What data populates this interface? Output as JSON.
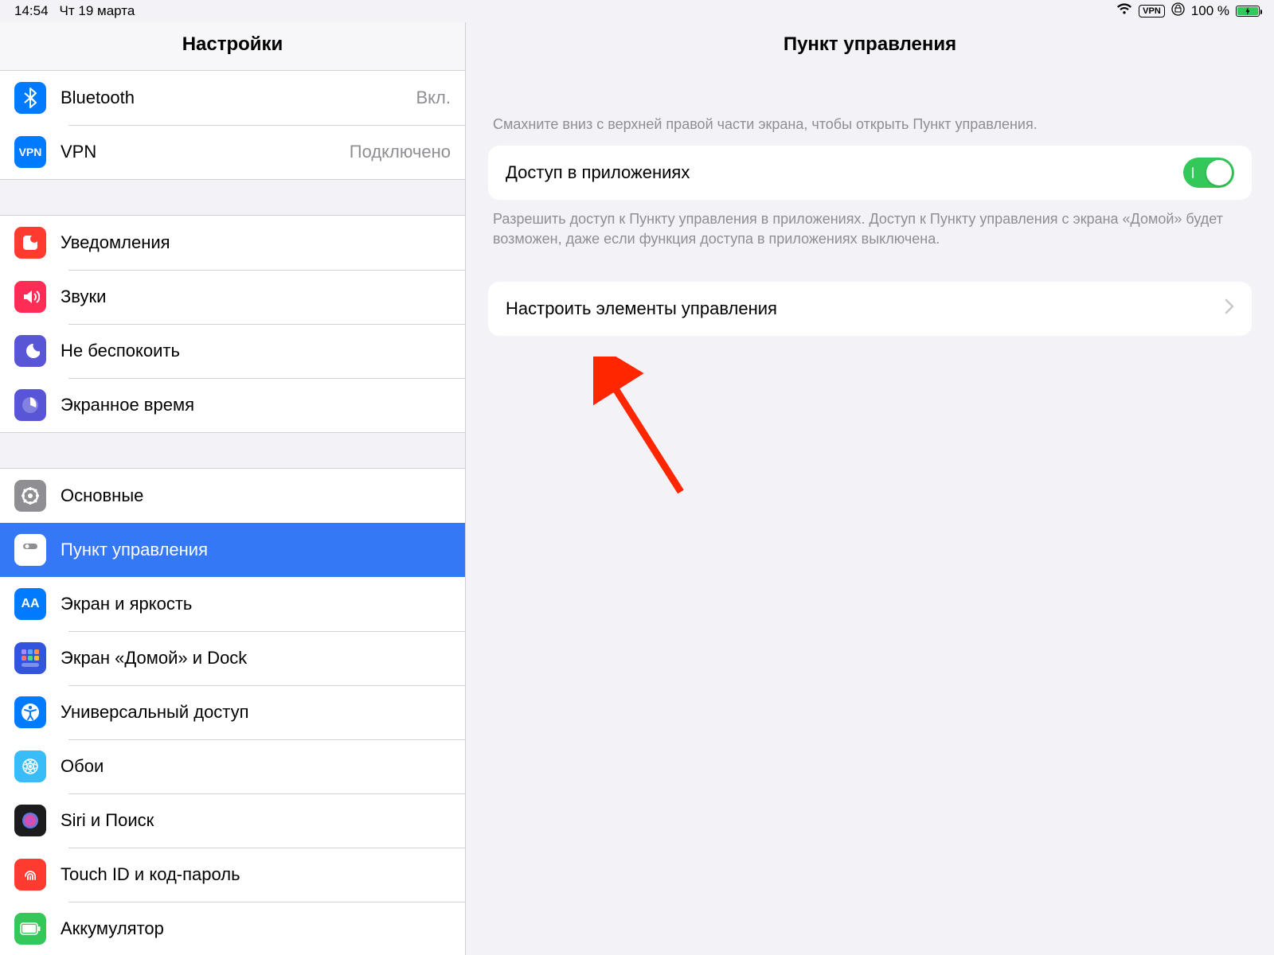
{
  "status": {
    "time": "14:54",
    "date": "Чт 19 марта",
    "vpn_label": "VPN",
    "battery_text": "100 %"
  },
  "sidebar": {
    "title": "Настройки",
    "group1": [
      {
        "label": "Bluetooth",
        "detail": "Вкл.",
        "icon": "bluetooth",
        "bg": "#007aff"
      },
      {
        "label": "VPN",
        "detail": "Подключено",
        "icon": "vpn",
        "bg": "#007aff"
      }
    ],
    "group2": [
      {
        "label": "Уведомления",
        "icon": "notifications",
        "bg": "#ff3b30"
      },
      {
        "label": "Звуки",
        "icon": "sounds",
        "bg": "#ff2d55"
      },
      {
        "label": "Не беспокоить",
        "icon": "dnd",
        "bg": "#5856d6"
      },
      {
        "label": "Экранное время",
        "icon": "screentime",
        "bg": "#5856d6"
      }
    ],
    "group3": [
      {
        "label": "Основные",
        "icon": "general",
        "bg": "#8e8e93"
      },
      {
        "label": "Пункт управления",
        "icon": "controlcenter",
        "bg": "#8e8e93",
        "selected": true
      },
      {
        "label": "Экран и яркость",
        "icon": "display",
        "bg": "#007aff"
      },
      {
        "label": "Экран «Домой» и Dock",
        "icon": "home",
        "bg": "#3355dd"
      },
      {
        "label": "Универсальный доступ",
        "icon": "accessibility",
        "bg": "#007aff"
      },
      {
        "label": "Обои",
        "icon": "wallpaper",
        "bg": "#38bdf8"
      },
      {
        "label": "Siri и Поиск",
        "icon": "siri",
        "bg": "#1c1c1e"
      },
      {
        "label": "Touch ID и код-пароль",
        "icon": "touchid",
        "bg": "#ff3b30"
      },
      {
        "label": "Аккумулятор",
        "icon": "battery",
        "bg": "#34c759"
      }
    ]
  },
  "detail": {
    "title": "Пункт управления",
    "intro": "Смахните вниз с верхней правой части экрана, чтобы открыть Пункт управления.",
    "access_label": "Доступ в приложениях",
    "access_note": "Разрешить доступ к Пункту управления в приложениях. Доступ к Пункту управления с экрана «Домой» будет возможен, даже если функция доступа в приложениях выключена.",
    "customize_label": "Настроить элементы управления"
  }
}
